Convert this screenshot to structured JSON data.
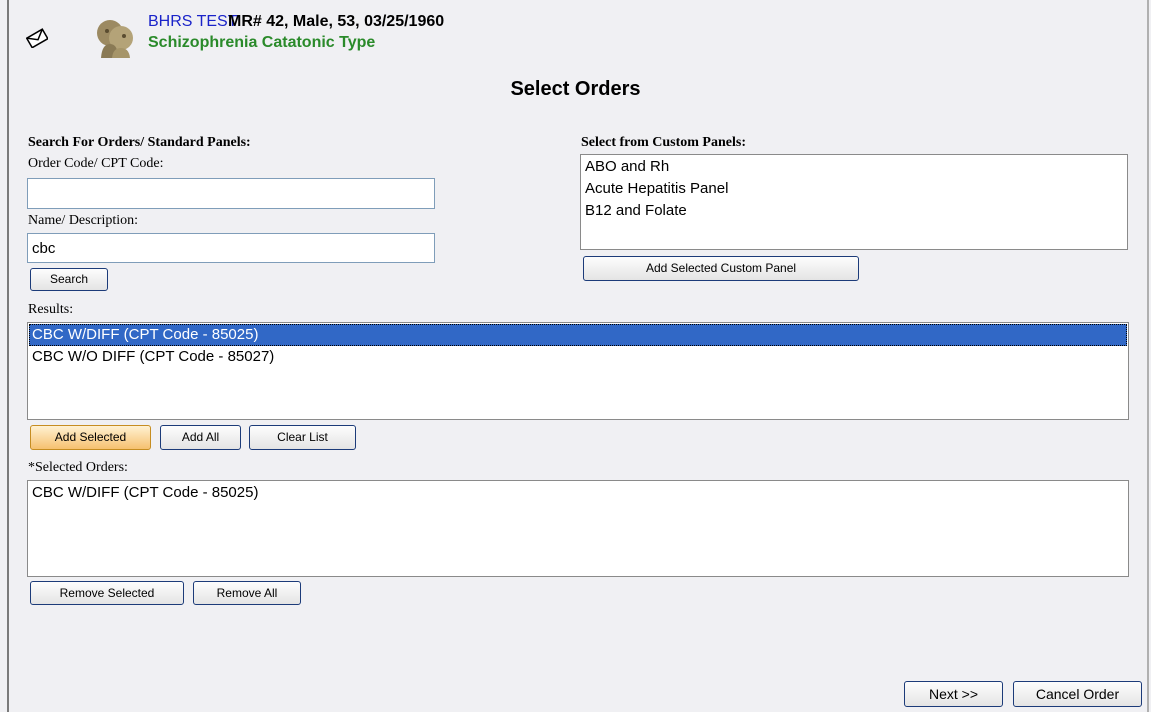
{
  "header": {
    "patient_name": "BHRS TEST",
    "patient_info": "MR# 42, Male, 53, 03/25/1960",
    "diagnosis": "Schizophrenia Catatonic Type",
    "mail_icon": "envelope-icon",
    "patient_icon": "two-people-icon"
  },
  "page_title": "Select Orders",
  "search": {
    "section_label": "Search For Orders/ Standard Panels:",
    "order_code_label": "Order Code/ CPT Code:",
    "order_code_value": "",
    "name_label": "Name/ Description:",
    "name_value": "cbc",
    "search_button": "Search"
  },
  "custom_panels": {
    "label": "Select from Custom Panels:",
    "items": [
      "ABO and Rh",
      "Acute Hepatitis Panel",
      "B12 and Folate"
    ],
    "add_button": "Add Selected Custom Panel"
  },
  "results": {
    "label": "Results:",
    "items": [
      {
        "text": "CBC W/DIFF (CPT Code - 85025)",
        "selected": true
      },
      {
        "text": "CBC W/O DIFF (CPT Code - 85027)",
        "selected": false
      }
    ],
    "add_selected_button": "Add Selected",
    "add_all_button": "Add All",
    "clear_list_button": "Clear List"
  },
  "selected_orders": {
    "label": "*Selected Orders:",
    "items": [
      "CBC W/DIFF (CPT Code - 85025)"
    ],
    "remove_selected_button": "Remove Selected",
    "remove_all_button": "Remove All"
  },
  "footer": {
    "next_button": "Next >>",
    "cancel_button": "Cancel Order"
  },
  "colors": {
    "patient_name": "#1a23c9",
    "diagnosis": "#2a8a2a",
    "selection": "#3168c6",
    "button_border": "#1c3b79"
  }
}
